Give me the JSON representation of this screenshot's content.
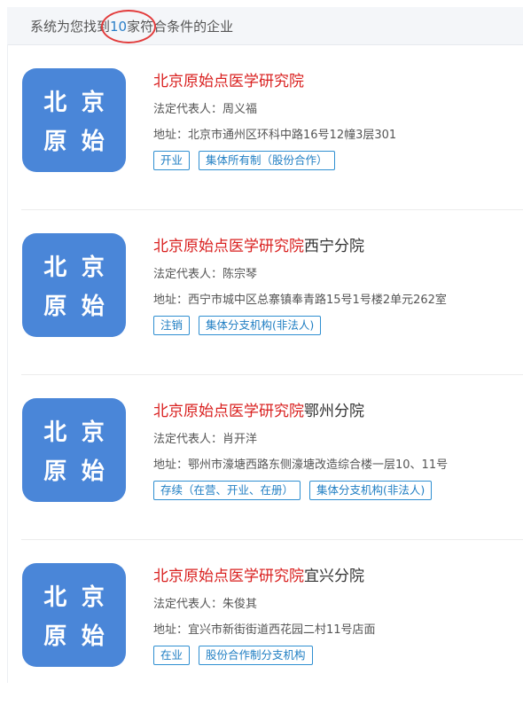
{
  "summary": {
    "prefix": "系统为您找到",
    "count": "10",
    "suffix": "家符合条件的企业"
  },
  "companies": [
    {
      "logo": [
        "北",
        "京",
        "原",
        "始"
      ],
      "name_highlight": "北京原始点医学研究院",
      "name_rest": "",
      "rep_label": "法定代表人：",
      "rep": "周义福",
      "addr_label": "地址：",
      "addr": "北京市通州区环科中路16号12幢3层301",
      "tags": [
        "开业",
        "集体所有制（股份合作）"
      ]
    },
    {
      "logo": [
        "北",
        "京",
        "原",
        "始"
      ],
      "name_highlight": "北京原始点医学研究院",
      "name_rest": "西宁分院",
      "rep_label": "法定代表人：",
      "rep": "陈宗琴",
      "addr_label": "地址：",
      "addr": "西宁市城中区总寨镇奉青路15号1号楼2单元262室",
      "tags": [
        "注销",
        "集体分支机构(非法人)"
      ]
    },
    {
      "logo": [
        "北",
        "京",
        "原",
        "始"
      ],
      "name_highlight": "北京原始点医学研究院",
      "name_rest": "鄂州分院",
      "rep_label": "法定代表人：",
      "rep": "肖开洋",
      "addr_label": "地址：",
      "addr": "鄂州市濠塘西路东侧濠塘改造综合楼一层10、11号",
      "tags": [
        "存续（在营、开业、在册）",
        "集体分支机构(非法人)"
      ]
    },
    {
      "logo": [
        "北",
        "京",
        "原",
        "始"
      ],
      "name_highlight": "北京原始点医学研究院",
      "name_rest": "宜兴分院",
      "rep_label": "法定代表人：",
      "rep": "朱俊其",
      "addr_label": "地址：",
      "addr": "宜兴市新街街道西花园二村11号店面",
      "tags": [
        "在业",
        "股份合作制分支机构"
      ]
    }
  ]
}
